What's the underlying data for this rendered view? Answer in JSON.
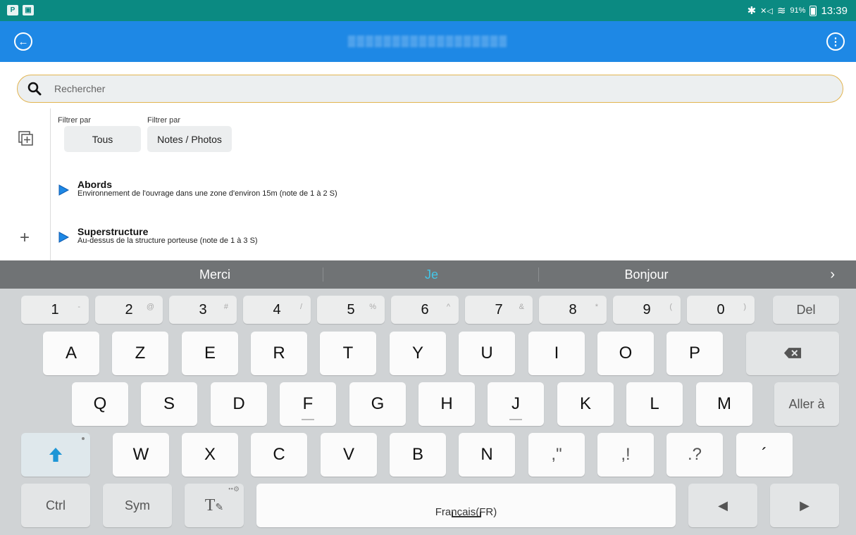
{
  "status_bar": {
    "battery": "91%",
    "time": "13:39"
  },
  "search": {
    "placeholder": "Rechercher"
  },
  "filters": [
    {
      "label": "Filtrer par",
      "value": "Tous"
    },
    {
      "label": "Filtrer par",
      "value": "Notes / Photos"
    }
  ],
  "items": [
    {
      "title": "Abords",
      "description": "Environnement de l'ouvrage dans une zone d'environ 15m (note de 1 à 2 S)"
    },
    {
      "title": "Superstructure",
      "description": "Au-dessus de la structure porteuse (note de 1 à 3 S)"
    }
  ],
  "suggestions": [
    "Merci",
    "Je",
    "Bonjour"
  ],
  "colors": {
    "status_bar": "#0b8a82",
    "app_bar": "#1e88e5",
    "search_border": "#e2b450",
    "suggestion_highlight": "#43c6e8",
    "play_icon": "#1e88e5"
  },
  "keyboard": {
    "numbers": [
      {
        "main": "1",
        "sub": "-"
      },
      {
        "main": "2",
        "sub": "@"
      },
      {
        "main": "3",
        "sub": "#"
      },
      {
        "main": "4",
        "sub": "/"
      },
      {
        "main": "5",
        "sub": "%"
      },
      {
        "main": "6",
        "sub": "^"
      },
      {
        "main": "7",
        "sub": "&"
      },
      {
        "main": "8",
        "sub": "*"
      },
      {
        "main": "9",
        "sub": "("
      },
      {
        "main": "0",
        "sub": ")"
      }
    ],
    "del": "Del",
    "row1": [
      "A",
      "Z",
      "E",
      "R",
      "T",
      "Y",
      "U",
      "I",
      "O",
      "P"
    ],
    "row2": [
      "Q",
      "S",
      "D",
      "F",
      "G",
      "H",
      "J",
      "K",
      "L",
      "M"
    ],
    "go": "Aller à",
    "row3": [
      "W",
      "X",
      "C",
      "V",
      "B",
      "N"
    ],
    "punct": [
      ",\"",
      ",!",
      ".?",
      "´"
    ],
    "ctrl": "Ctrl",
    "sym": "Sym",
    "text_tool": "T",
    "space_label": "Français(FR)"
  }
}
